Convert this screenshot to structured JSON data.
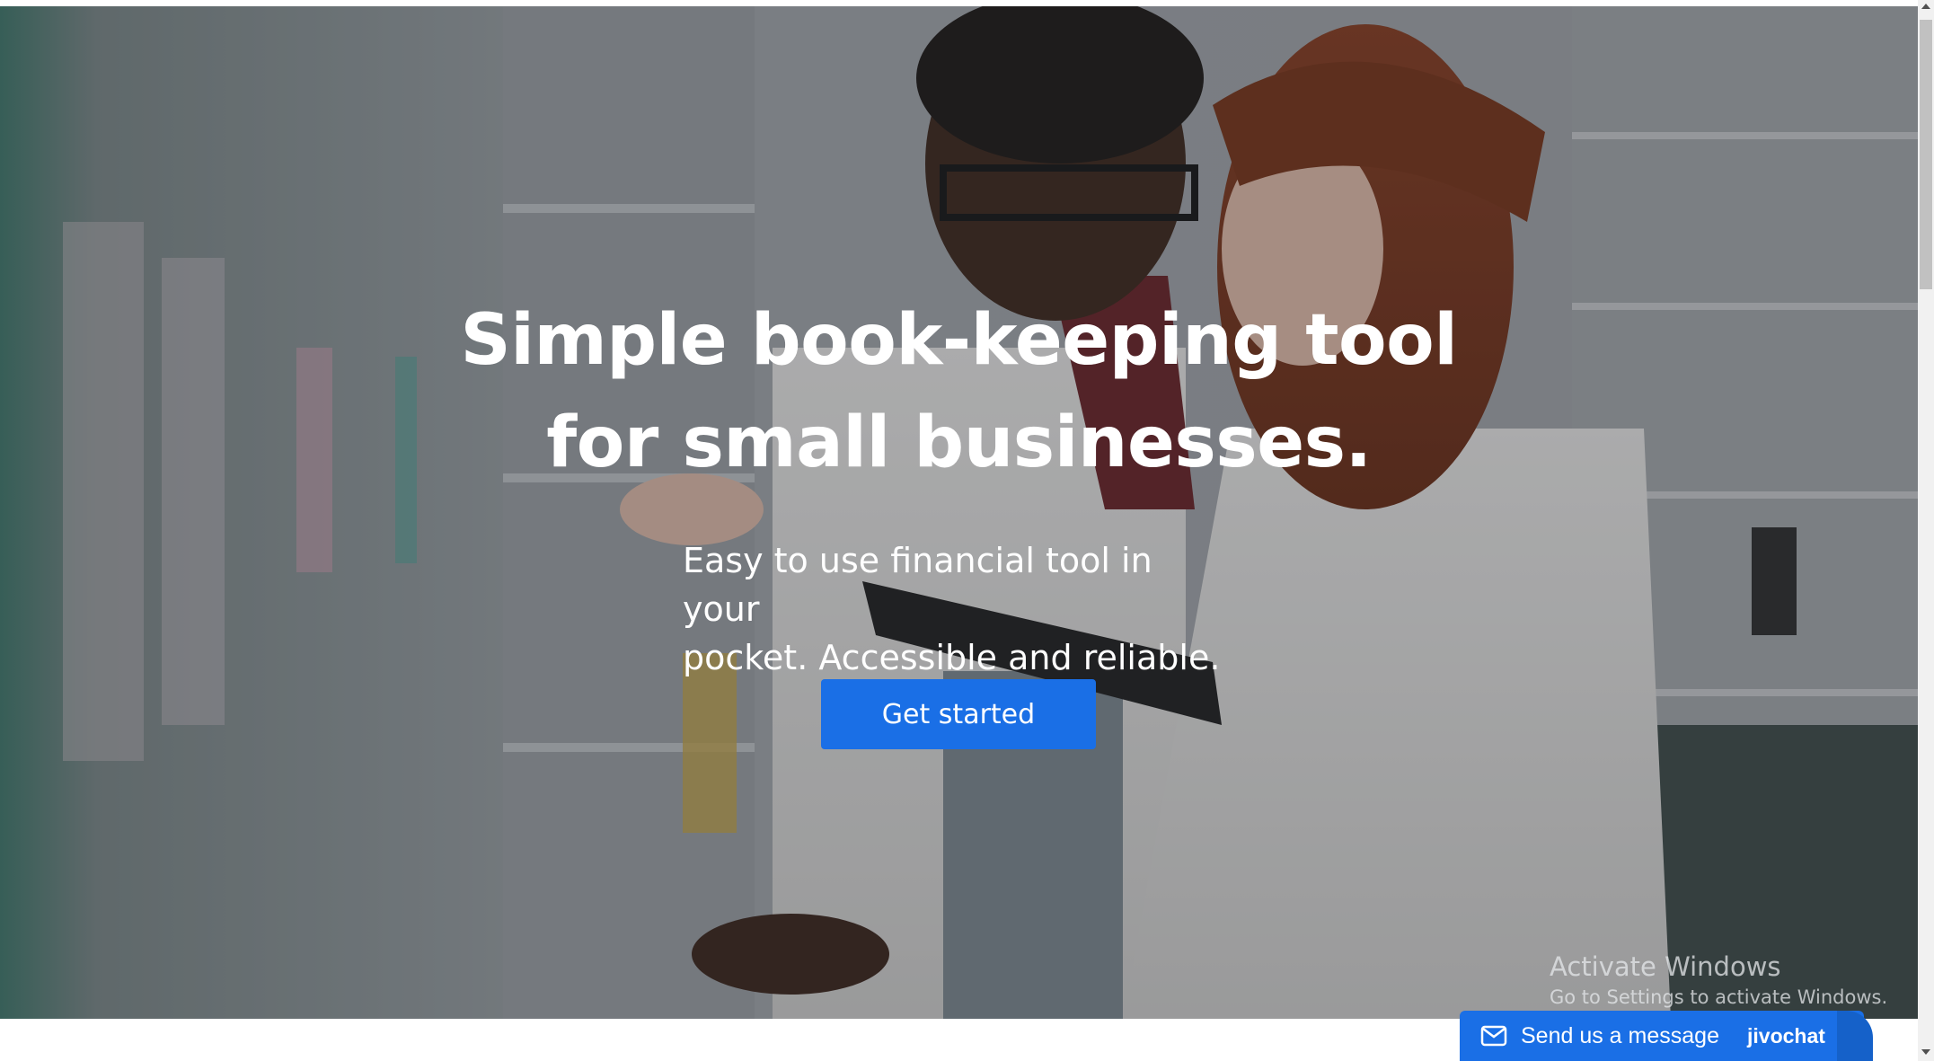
{
  "hero": {
    "title_line1": "Simple book-keeping tool",
    "title_line2": "for small businesses.",
    "subtitle_line1": "Easy to use financial tool in your",
    "subtitle_line2": "pocket. Accessible and reliable.",
    "cta_label": "Get started",
    "cta_color": "#1a6fe6",
    "background_image": "pharmacy-staff-photo"
  },
  "chat_widget": {
    "label": "Send us a message",
    "brand": "jivochat",
    "icon": "mail-icon",
    "color": "#1a6fe6"
  },
  "os_watermark": {
    "title": "Activate Windows",
    "subtitle": "Go to Settings to activate Windows."
  }
}
